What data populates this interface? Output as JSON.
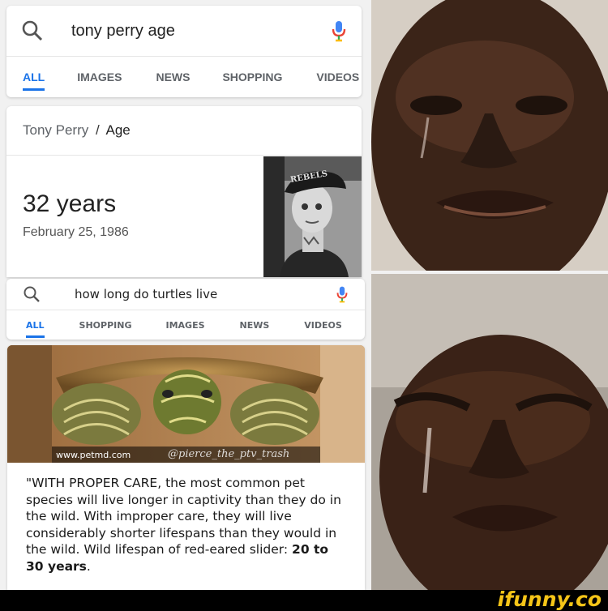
{
  "search1": {
    "query": "tony perry age",
    "tabs": [
      "ALL",
      "IMAGES",
      "NEWS",
      "SHOPPING",
      "VIDEOS"
    ]
  },
  "knowledge": {
    "breadcrumb_name": "Tony Perry",
    "breadcrumb_sep": "/",
    "breadcrumb_attr": "Age",
    "age": "32 years",
    "dob": "February 25, 1986",
    "hat_text": "REBELS"
  },
  "search2": {
    "query": "how long do turtles live",
    "tabs": [
      "ALL",
      "SHOPPING",
      "IMAGES",
      "NEWS",
      "VIDEOS"
    ]
  },
  "turtle_card": {
    "source": "www.petmd.com",
    "watermark": "@pierce_the_ptv_trash",
    "snippet": "\"WITH PROPER CARE, the most common pet species will live longer in captivity than they do in the wild. With improper care, they will live considerably shorter lifespans than they would in the wild. Wild lifespan of red-eared slider: ",
    "snippet_bold": "20 to 30 years",
    "snippet_end": "."
  },
  "footer": {
    "brand": "ifunny.co"
  },
  "colors": {
    "accent": "#1a73e8",
    "mic_blue": "#4285f4",
    "mic_red": "#ea4335",
    "mic_yellow": "#fbbc05",
    "mic_green": "#34a853",
    "footer_bg": "#000000",
    "brand": "#f5c518"
  }
}
